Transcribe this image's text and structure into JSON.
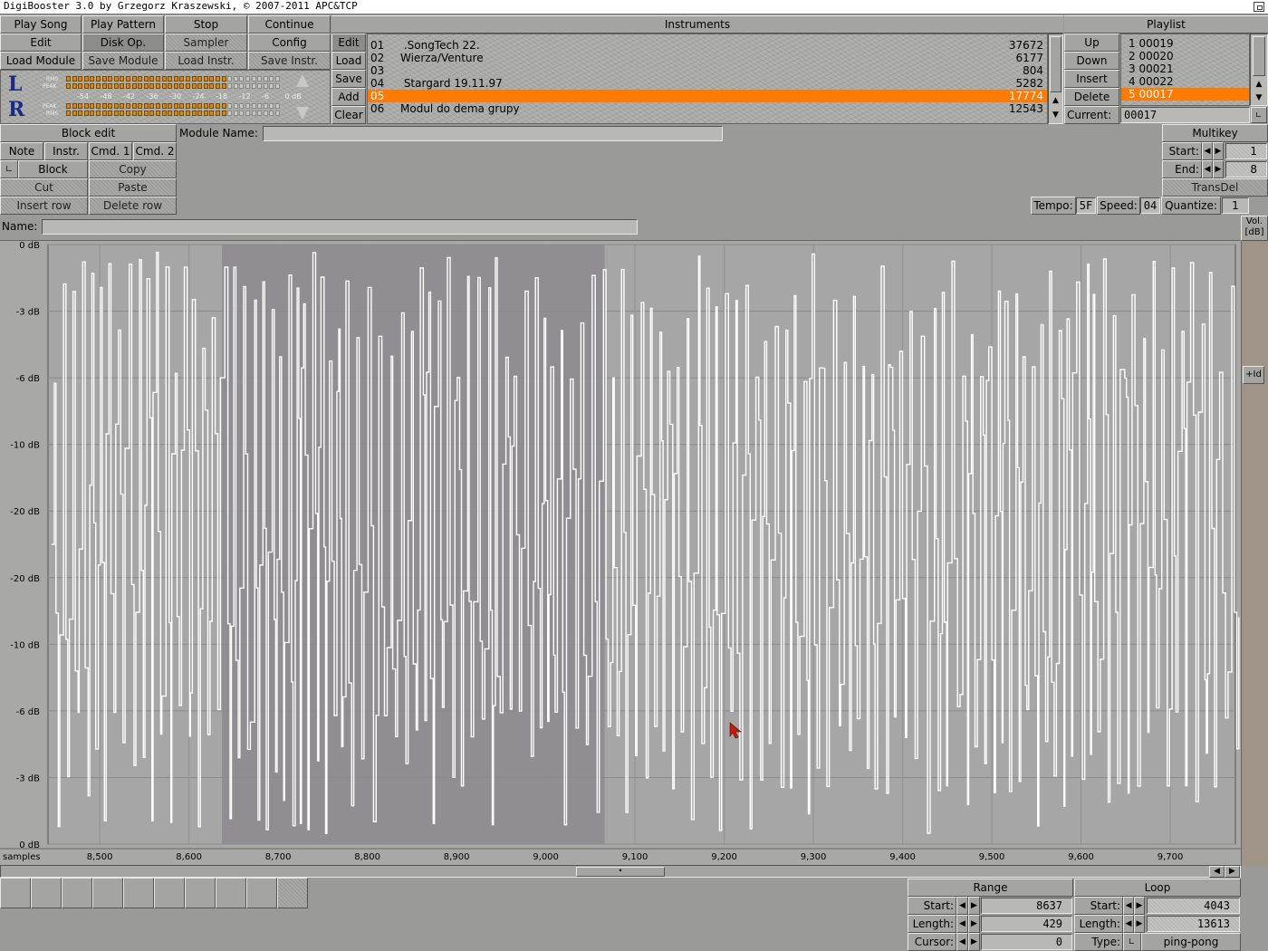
{
  "window_title": "DigiBooster 3.0 by Grzegorz Kraszewski, © 2007-2011 APC&TCP",
  "buttons": {
    "play_song": "Play Song",
    "play_pattern": "Play Pattern",
    "stop": "Stop",
    "continue": "Continue",
    "edit": "Edit",
    "disk_op": "Disk Op.",
    "sampler": "Sampler",
    "config": "Config",
    "load_module": "Load Module",
    "save_module": "Save Module",
    "load_instr": "Load Instr.",
    "save_instr": "Save Instr."
  },
  "vu": {
    "left": "L",
    "right": "R",
    "rms": "RMS",
    "peak": "PEAK",
    "scale": [
      "-54",
      "-48",
      "-42",
      "-36",
      "-30",
      "-24",
      "-18",
      "-12",
      "-6",
      "0 dB"
    ],
    "left_level": 0.74,
    "right_level": 0.74
  },
  "instruments": {
    "title": "Instruments",
    "buttons": [
      "Edit",
      "Load",
      "Save",
      "Add",
      "Clear"
    ],
    "items": [
      {
        "num": "01",
        "name": " .SongTech 22.",
        "size": "37672"
      },
      {
        "num": "02",
        "name": "Wierza/Venture",
        "size": "6177"
      },
      {
        "num": "03",
        "name": "",
        "size": "804"
      },
      {
        "num": "04",
        "name": " Stargard 19.11.97",
        "size": "5282"
      },
      {
        "num": "05",
        "name": "",
        "size": "17774"
      },
      {
        "num": "06",
        "name": "Modul do dema grupy",
        "size": "12543"
      }
    ],
    "selected_index": 4
  },
  "playlist": {
    "title": "Playlist",
    "buttons": [
      "Up",
      "Down",
      "Insert",
      "Delete"
    ],
    "items": [
      "1 00019",
      "2 00020",
      "3 00021",
      "4 00022",
      "5 00017"
    ],
    "selected_index": 4,
    "current_label": "Current:",
    "current_value": "00017"
  },
  "block_edit": {
    "title": "Block edit",
    "tabs": [
      "Note",
      "Instr.",
      "Cmd. 1",
      "Cmd. 2"
    ],
    "block": "Block",
    "copy": "Copy",
    "cut": "Cut",
    "paste": "Paste",
    "insert_row": "Insert row",
    "delete_row": "Delete row"
  },
  "module_name_label": "Module Name:",
  "module_name_value": "",
  "multikey": {
    "title": "Multikey",
    "start_label": "Start:",
    "start_value": "1",
    "end_label": "End:",
    "end_value": "8",
    "transdel": "TransDel"
  },
  "tempo": {
    "tempo_label": "Tempo:",
    "tempo_value": "5F",
    "speed_label": "Speed:",
    "speed_value": "04",
    "quantize_label": "Quantize:",
    "quantize_value": "1"
  },
  "sample_name_label": "Name:",
  "sample_name_value": "",
  "waveform": {
    "db_labels": [
      "0 dB",
      "-3 dB",
      "-6 dB",
      "-10 dB",
      "-20 dB",
      "-20 dB",
      "-10 dB",
      "-6 dB",
      "-3 dB",
      "0 dB"
    ],
    "x_unit_label": "samples",
    "x_ticks": [
      "8,500",
      "8,600",
      "8,700",
      "8,800",
      "8,900",
      "9,000",
      "9,100",
      "9,200",
      "9,300",
      "9,400",
      "9,500",
      "9,600",
      "9,700"
    ],
    "view_start": 8442,
    "view_end": 9773,
    "range_start": 8637,
    "range_length": 429,
    "loop_start": 4043,
    "vol_label": "Vol. [dB]",
    "vol_button": "+Id"
  },
  "range_panel": {
    "title": "Range",
    "start_label": "Start:",
    "start_value": "8637",
    "length_label": "Length:",
    "length_value": "429",
    "cursor_label": "Cursor:",
    "cursor_value": "0"
  },
  "loop_panel": {
    "title": "Loop",
    "start_label": "Start:",
    "start_value": "4043",
    "length_label": "Length:",
    "length_value": "13613",
    "type_label": "Type:",
    "type_value": "ping-pong"
  },
  "colors": {
    "selected": "#ff7a00",
    "range": "#908e92",
    "waveform_bg": "#a6a6a6",
    "wave": "#ffffff"
  }
}
